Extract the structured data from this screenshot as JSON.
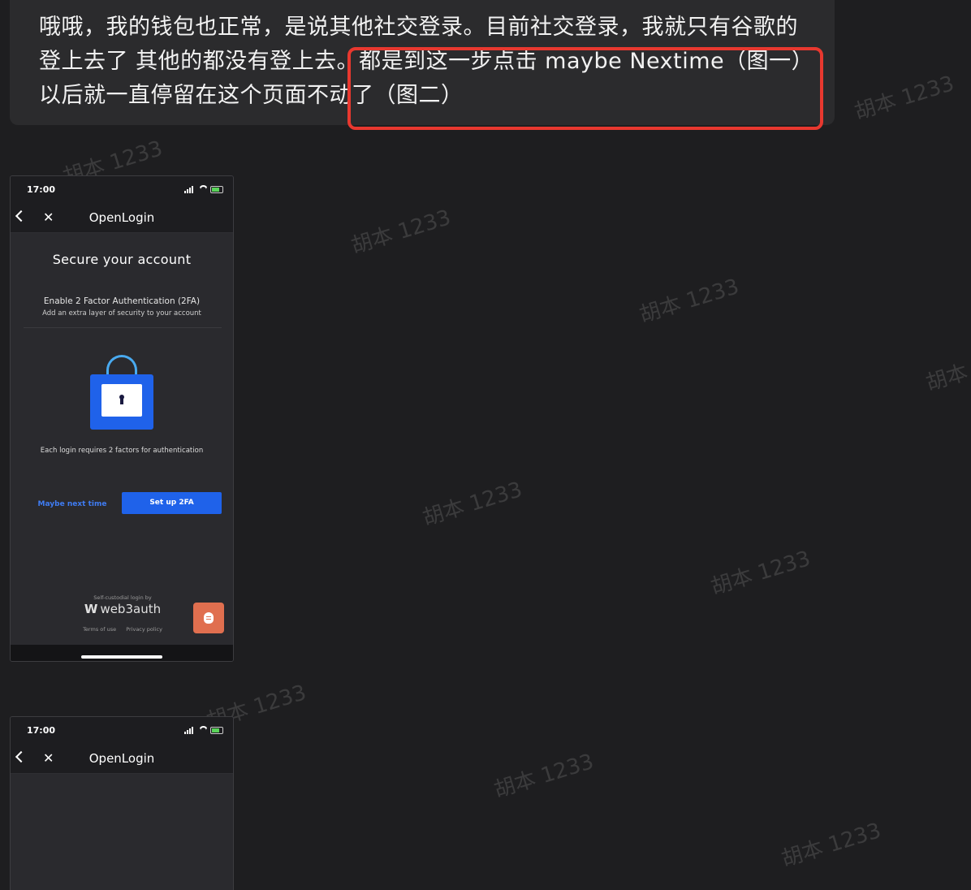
{
  "message": {
    "line1": "哦哦，我的钱包也正常，是说其他社交登录。目前社交登录，我就只有谷歌的",
    "line2": "登上去了 其他的都没有登上去。都是到这一步点击 maybe Nextime（图一）",
    "line3": "以后就一直停留在这个页面不动了（图二）"
  },
  "watermark": "胡本 1233",
  "screenshot1": {
    "time": "17:00",
    "nav_title": "OpenLogin",
    "close_glyph": "✕",
    "heading": "Secure your account",
    "twofa_title": "Enable 2 Factor Authentication (2FA)",
    "twofa_subtitle": "Add an extra layer of security to your account",
    "each_login_text": "Each login requires 2 factors for authentication",
    "maybe_label": "Maybe next time",
    "setup_label": "Set up 2FA",
    "self_custodial": "Self-custodial login by",
    "brand_mark": "W",
    "brand_name": "web3auth",
    "terms": "Terms of use",
    "privacy": "Privacy policy",
    "accent_color": "#1f62ea",
    "bug_button_color": "#e06f4f"
  },
  "screenshot2": {
    "time": "17:00",
    "nav_title": "OpenLogin",
    "close_glyph": "✕"
  },
  "colors": {
    "background": "#1e1e20",
    "bubble": "#2b2b2d",
    "highlight": "#e8382f"
  }
}
